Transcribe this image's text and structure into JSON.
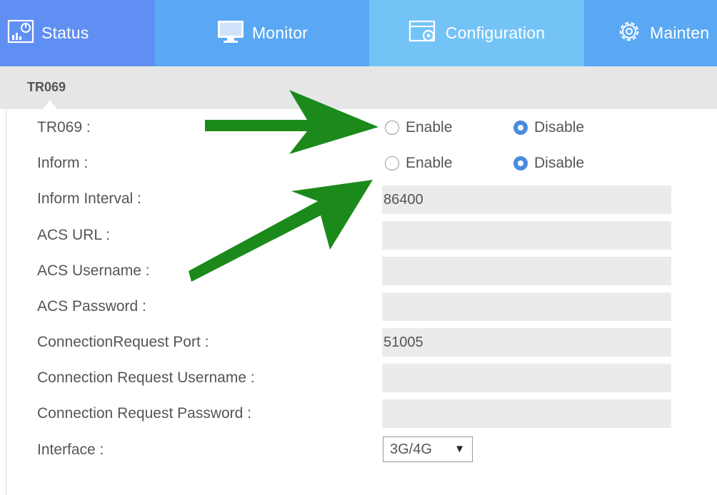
{
  "nav": {
    "tabs": [
      {
        "label": "Status",
        "icon": "status-chart-icon"
      },
      {
        "label": "Monitor",
        "icon": "monitor-icon"
      },
      {
        "label": "Configuration",
        "icon": "configuration-icon"
      },
      {
        "label": "Mainten",
        "icon": "gear-icon"
      }
    ],
    "active": "Configuration"
  },
  "section": {
    "title": "TR069"
  },
  "form": {
    "tr069": {
      "label": "TR069 :",
      "enable": "Enable",
      "disable": "Disable",
      "selected": "Disable"
    },
    "inform": {
      "label": "Inform :",
      "enable": "Enable",
      "disable": "Disable",
      "selected": "Disable"
    },
    "inform_interval": {
      "label": "Inform Interval :",
      "value": "86400"
    },
    "acs_url": {
      "label": "ACS URL :",
      "value": ""
    },
    "acs_username": {
      "label": "ACS Username :",
      "value": ""
    },
    "acs_password": {
      "label": "ACS Password :",
      "value": ""
    },
    "conn_port": {
      "label": "ConnectionRequest Port :",
      "value": "51005"
    },
    "conn_username": {
      "label": "Connection Request Username :",
      "value": ""
    },
    "conn_password": {
      "label": "Connection Request Password :",
      "value": ""
    },
    "interface": {
      "label": "Interface :",
      "value": "3G/4G"
    }
  },
  "colors": {
    "annotation_arrow": "#1b8a1b",
    "radio_selected": "#4a8be0",
    "tab_active": "#74c3f7"
  }
}
